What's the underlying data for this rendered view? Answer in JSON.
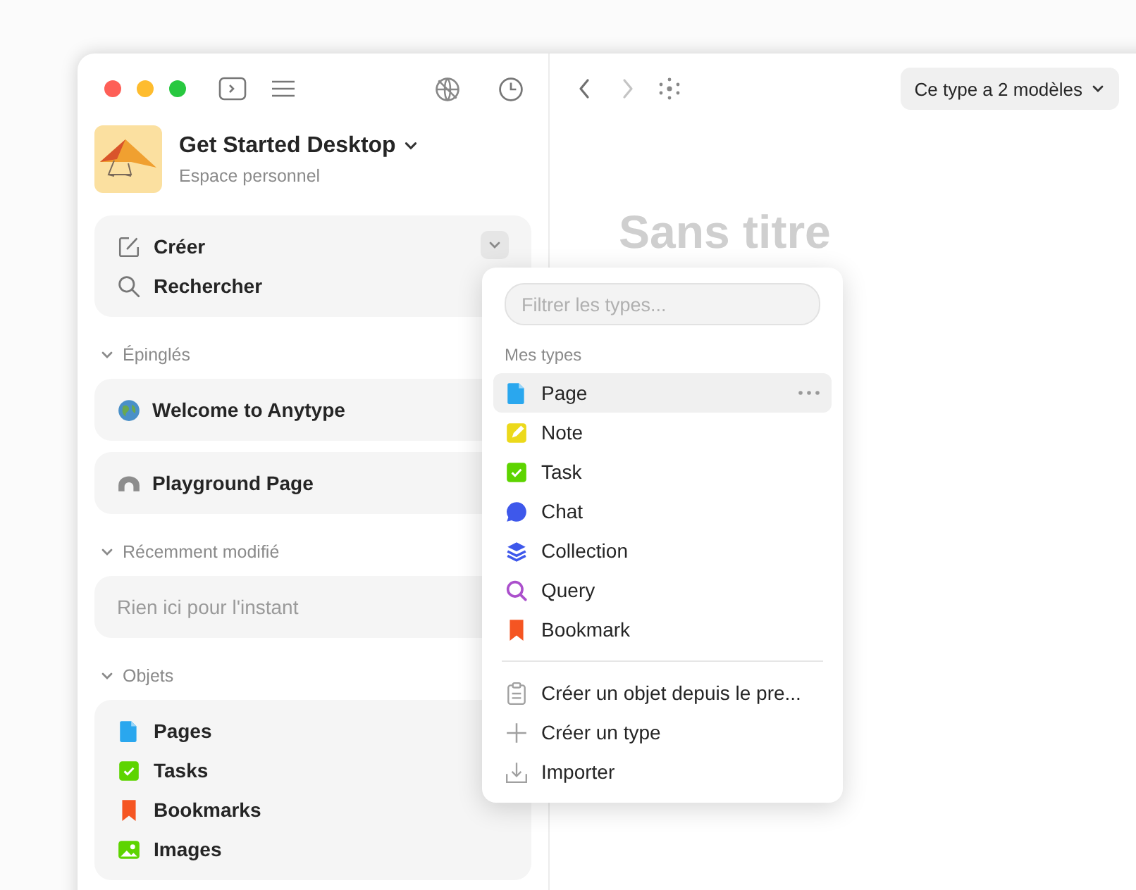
{
  "space": {
    "title": "Get Started Desktop",
    "subtitle": "Espace personnel"
  },
  "quick_actions": [
    {
      "kind": "create",
      "label": "Créer"
    },
    {
      "kind": "search",
      "label": "Rechercher"
    }
  ],
  "sections": [
    {
      "title": "Épinglés",
      "expanded": true,
      "kind": "cards",
      "items": [
        {
          "kind": "globe",
          "label": "Welcome to Anytype"
        },
        {
          "kind": "arch",
          "label": "Playground Page"
        }
      ]
    },
    {
      "title": "Récemment modifié",
      "expanded": true,
      "kind": "empty",
      "text": "Rien ici pour l'instant"
    },
    {
      "title": "Objets",
      "expanded": true,
      "kind": "list",
      "items": [
        {
          "kind": "page",
          "label": "Pages"
        },
        {
          "kind": "task",
          "label": "Tasks"
        },
        {
          "kind": "bookmark",
          "label": "Bookmarks"
        },
        {
          "kind": "image",
          "label": "Images"
        }
      ]
    }
  ],
  "nav_buttons": [
    {
      "kind": "back",
      "disabled": false
    },
    {
      "kind": "forward",
      "disabled": true
    }
  ],
  "template_button": "Ce type a 2 modèles",
  "document_title": "Sans titre",
  "type_menu": {
    "filter_placeholder": "Filtrer les types...",
    "group_title": "Mes types",
    "types": [
      {
        "kind": "page",
        "label": "Page",
        "selected": true
      },
      {
        "kind": "note",
        "label": "Note",
        "selected": false
      },
      {
        "kind": "task",
        "label": "Task",
        "selected": false
      },
      {
        "kind": "chat",
        "label": "Chat",
        "selected": false
      },
      {
        "kind": "collection",
        "label": "Collection",
        "selected": false
      },
      {
        "kind": "query",
        "label": "Query",
        "selected": false
      },
      {
        "kind": "bookmark",
        "label": "Bookmark",
        "selected": false
      }
    ],
    "actions": [
      {
        "kind": "clipboard",
        "label": "Créer un objet depuis le pre..."
      },
      {
        "kind": "plus",
        "label": "Créer un type"
      },
      {
        "kind": "import",
        "label": "Importer"
      }
    ]
  }
}
